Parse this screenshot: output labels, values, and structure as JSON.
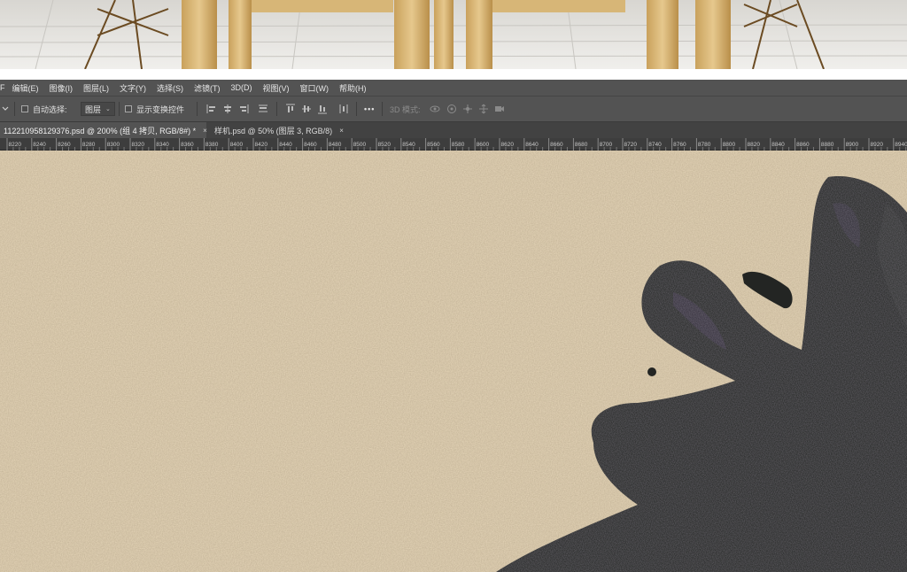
{
  "menu": {
    "items": [
      "F",
      "编辑(E)",
      "图像(I)",
      "图层(L)",
      "文字(Y)",
      "选择(S)",
      "滤镜(T)",
      "3D(D)",
      "视图(V)",
      "窗口(W)",
      "帮助(H)"
    ]
  },
  "options": {
    "auto_select_label": "自动选择:",
    "auto_select_value": "图层",
    "show_transform_label": "显示变换控件",
    "more_label": "•••",
    "mode_3d_label": "3D 模式:"
  },
  "tabs": [
    {
      "label": "112210958129376.psd @ 200% (组 4 拷贝, RGB/8#) *",
      "close": "×"
    },
    {
      "label": "样机.psd @ 50% (图层 3, RGB/8)",
      "close": "×"
    }
  ],
  "ruler": {
    "ticks": [
      "8220",
      "8240",
      "8260",
      "8280",
      "8300",
      "8320",
      "8340",
      "8360",
      "8380",
      "8400",
      "8420",
      "8440",
      "8460",
      "8480",
      "8500",
      "8520",
      "8540",
      "8560",
      "8580",
      "8600",
      "8620",
      "8640",
      "8660",
      "8680",
      "8700",
      "8720",
      "8740",
      "8760",
      "8780",
      "8800",
      "8820",
      "8840",
      "8860",
      "8880",
      "8900",
      "8920",
      "8940"
    ]
  },
  "icons": {
    "options_menu": "chevron-down-icon",
    "align": [
      "align-left-icon",
      "align-center-icon",
      "align-right-icon",
      "align-justify-icon",
      "align-top-icon",
      "align-middle-icon",
      "align-bottom-icon",
      "distribute-icon"
    ],
    "mode3d": [
      "orbit-icon",
      "roll-icon",
      "pan-icon",
      "slide-icon",
      "scale-camera-icon"
    ]
  },
  "colors": {
    "chrome": "#535353",
    "tab_bar": "#424242",
    "ruler": "#3d3d3d",
    "canvas_texture": "#e3d3b6",
    "ink": "#232523"
  }
}
